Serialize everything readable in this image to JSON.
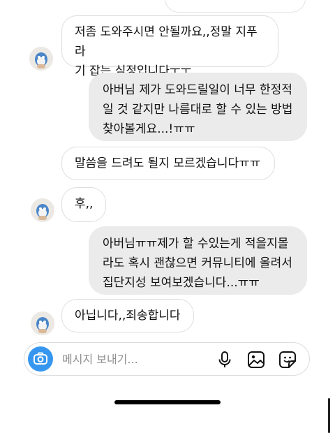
{
  "messages": [
    {
      "side": "in",
      "text": "저좀 도와주시면 안될까요,,정말 지푸라\n기 잡는 심정입니다ㅜㅜ"
    },
    {
      "side": "out",
      "text": "아버님 제가 도와드릴일이 너무 한정적\n일 것 같지만 나름대로 할 수 있는 방법\n찾아볼게요...!ㅠㅠ"
    },
    {
      "side": "in",
      "text": "말씀을 드려도 될지 모르겠습니다ㅠㅠ"
    },
    {
      "side": "in",
      "text": "후,,"
    },
    {
      "side": "out",
      "text": "아버님ㅠㅠ제가 할 수있는게 적을지몰\n라도 혹시 괜찮으면 커뮤니티에 올려서\n집단지성 보여보겠습니다...ㅠㅠ"
    },
    {
      "side": "in",
      "text": "아닙니다,,죄송합니다"
    }
  ],
  "composer": {
    "placeholder": "메시지 보내기...",
    "value": "",
    "icons": [
      "camera-icon",
      "microphone-icon",
      "gallery-icon",
      "sticker-icon"
    ],
    "camera_color": "#3797f0"
  },
  "colors": {
    "incoming_bg": "#ffffff",
    "incoming_border": "#dedede",
    "outgoing_bg": "#ebebeb"
  }
}
